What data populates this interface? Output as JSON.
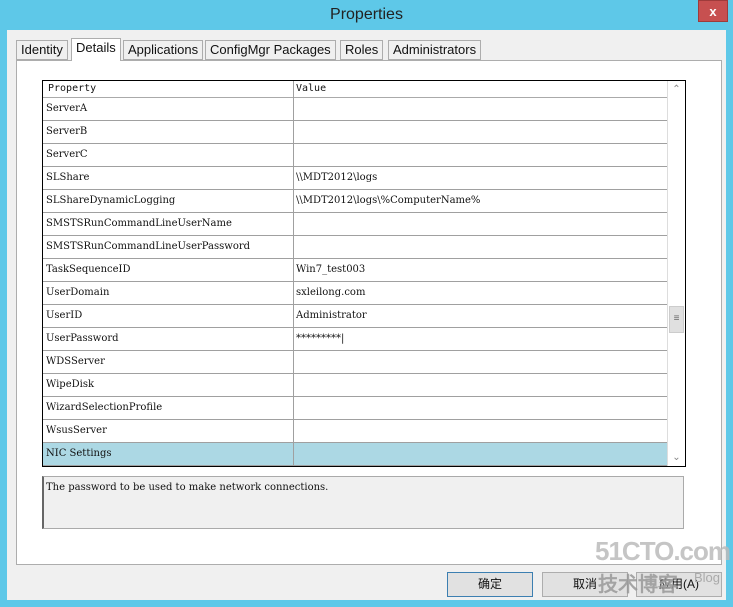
{
  "window": {
    "title": "Properties",
    "close": "x"
  },
  "tabs": [
    "Identity",
    "Details",
    "Applications",
    "ConfigMgr Packages",
    "Roles",
    "Administrators"
  ],
  "active_tab": "Details",
  "grid": {
    "headers": {
      "property": "Property",
      "value": "Value"
    },
    "rows": [
      {
        "k": "ServerA",
        "v": ""
      },
      {
        "k": "ServerB",
        "v": ""
      },
      {
        "k": "ServerC",
        "v": ""
      },
      {
        "k": "SLShare",
        "v": "\\\\MDT2012\\logs"
      },
      {
        "k": "SLShareDynamicLogging",
        "v": "\\\\MDT2012\\logs\\%ComputerName%"
      },
      {
        "k": "SMSTSRunCommandLineUserName",
        "v": ""
      },
      {
        "k": "SMSTSRunCommandLineUserPassword",
        "v": ""
      },
      {
        "k": "TaskSequenceID",
        "v": "Win7_test003"
      },
      {
        "k": "UserDomain",
        "v": "sxleilong.com"
      },
      {
        "k": "UserID",
        "v": "Administrator"
      },
      {
        "k": "UserPassword",
        "v": "*********|"
      },
      {
        "k": "WDSServer",
        "v": ""
      },
      {
        "k": "WipeDisk",
        "v": ""
      },
      {
        "k": "WizardSelectionProfile",
        "v": ""
      },
      {
        "k": "WsusServer",
        "v": ""
      },
      {
        "k": "NIC Settings",
        "v": ""
      }
    ],
    "selected_row": "NIC Settings",
    "selected_color": "#acd8e4"
  },
  "description": "The password to be used to make network connections.",
  "buttons": {
    "ok": "确定",
    "cancel": "取消",
    "apply": "应用(A)"
  },
  "watermark": {
    "line1": "51CTO.com",
    "line2": "技术博客",
    "line3": "Blog"
  }
}
